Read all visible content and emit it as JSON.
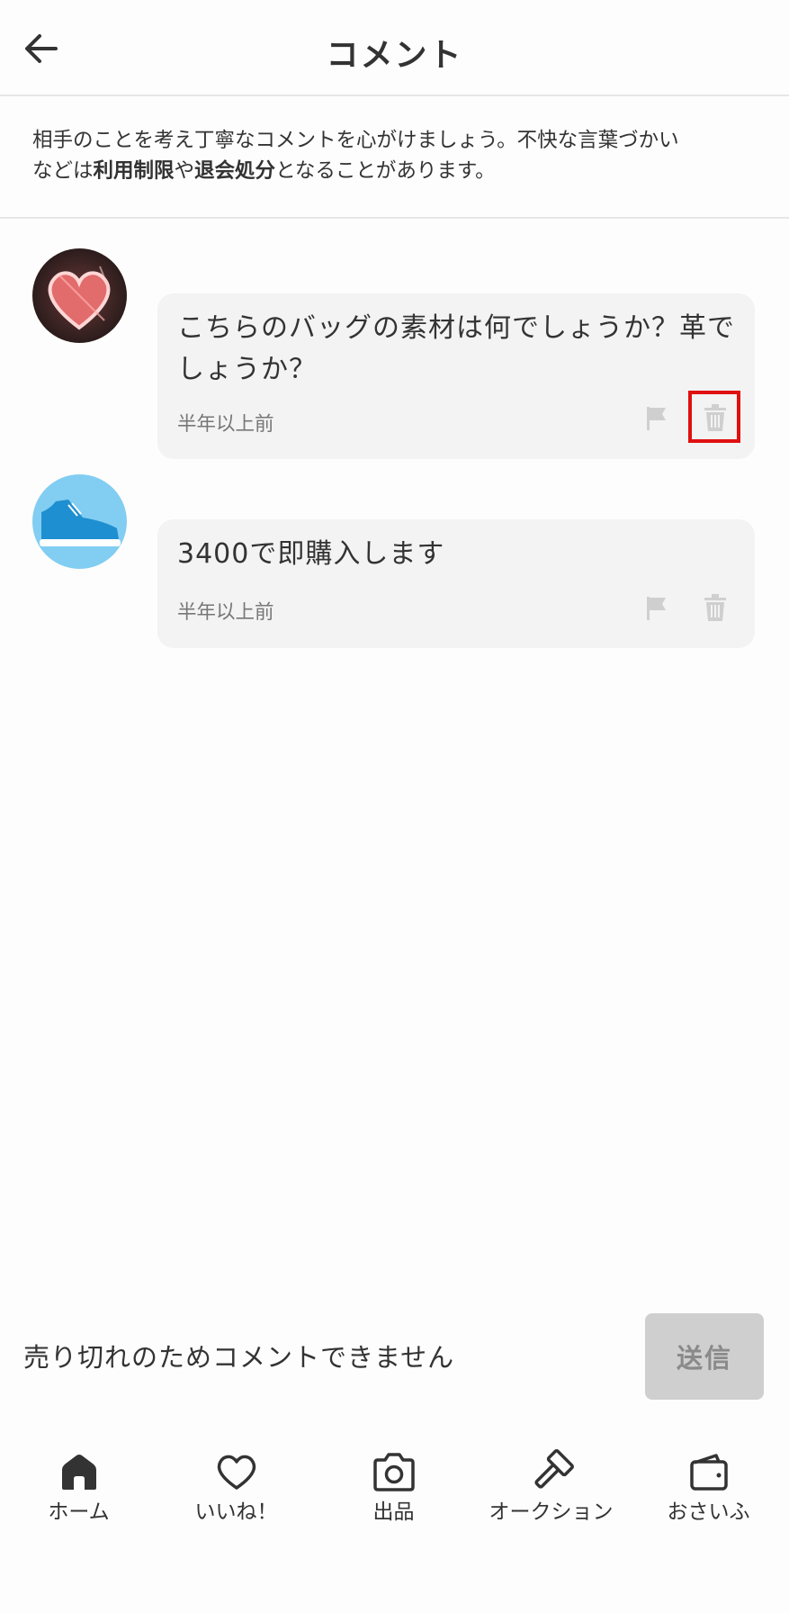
{
  "header": {
    "title": "コメント"
  },
  "notice": {
    "part1": "相手のことを考え丁寧なコメントを心がけましょう。不快な言葉づかい",
    "part2": "などは",
    "bold1": "利用制限",
    "part3": "や",
    "bold2": "退会処分",
    "part4": "となることがあります。"
  },
  "comments": [
    {
      "text": "こちらのバッグの素材は何でしょうか？革でしょうか？",
      "time": "半年以上前",
      "avatar": "heart-avatar"
    },
    {
      "text": "3400で即購入します",
      "time": "半年以上前",
      "avatar": "sneaker-avatar"
    }
  ],
  "input": {
    "placeholder": "売り切れのためコメントできません",
    "send_label": "送信"
  },
  "tabs": [
    {
      "label": "ホーム",
      "icon": "home-icon"
    },
    {
      "label": "いいね！",
      "icon": "heart-icon"
    },
    {
      "label": "出品",
      "icon": "camera-icon"
    },
    {
      "label": "オークション",
      "icon": "hammer-icon"
    },
    {
      "label": "おさいふ",
      "icon": "wallet-icon"
    }
  ],
  "colors": {
    "highlight": "#e01010",
    "bubble": "#f3f3f3",
    "send_disabled": "#cfcfcf"
  }
}
